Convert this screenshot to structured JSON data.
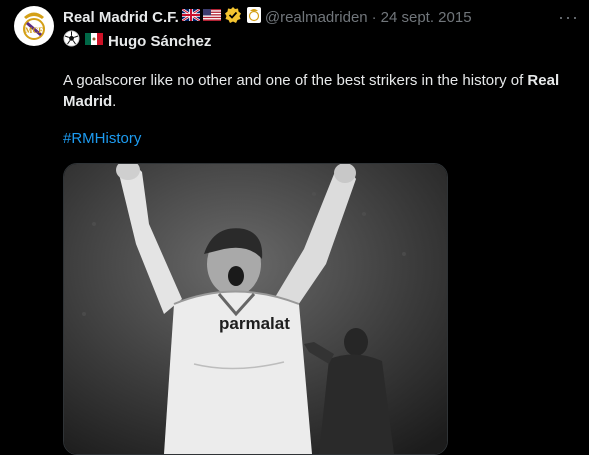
{
  "author": {
    "display_name": "Real Madrid C.F.",
    "handle": "@realmadriden",
    "date_separator": "·",
    "date": "24 sept. 2015",
    "icons": [
      "uk-flag-icon",
      "us-flag-icon",
      "verified-badge-icon",
      "club-crest-icon"
    ]
  },
  "subtitle": {
    "icons": [
      "soccer-ball-icon",
      "mexico-flag-icon"
    ],
    "player_name": "Hugo Sánchez"
  },
  "tweet": {
    "text_before": "A goalscorer like no other and one of the best strikers in the history of ",
    "text_bold": "Real Madrid",
    "text_after": ".",
    "hashtag": "#RMHistory"
  },
  "media": {
    "shirt_sponsor": "parmalat"
  },
  "menu": {
    "more_label": "···"
  },
  "colors": {
    "background": "#000000",
    "text": "#e7e9ea",
    "muted": "#71767b",
    "link": "#1d9bf0",
    "verified": "#f4c430"
  }
}
